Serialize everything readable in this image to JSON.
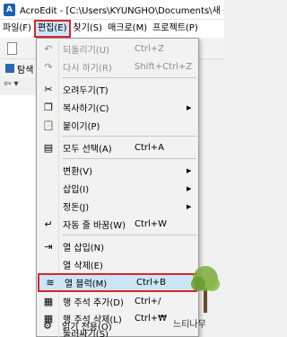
{
  "window": {
    "title": "AcroEdit - [C:\\Users\\KYUNGHO\\Documents\\새 문서",
    "icon_letter": "A"
  },
  "menubar": [
    {
      "label": "파일(F)"
    },
    {
      "label": "편집(E)",
      "active": true
    },
    {
      "label": "찾기(S)"
    },
    {
      "label": "매크로(M)"
    },
    {
      "label": "프로젝트(P)"
    }
  ],
  "side_tab": {
    "label": "탐색"
  },
  "side_nav": {
    "label": "⇦ ▾"
  },
  "edit_menu": {
    "items": [
      {
        "label": "되돌리기(U)",
        "shortcut": "Ctrl+Z",
        "icon": "undo-icon",
        "disabled": true
      },
      {
        "label": "다시 하기(R)",
        "shortcut": "Shift+Ctrl+Z",
        "icon": "redo-icon",
        "disabled": true
      },
      {
        "separator": true
      },
      {
        "label": "오려두기(T)",
        "icon": "scissors-icon"
      },
      {
        "label": "복사하기(C)",
        "icon": "copy-icon",
        "submenu": true
      },
      {
        "label": "붙이기(P)",
        "icon": "paste-icon"
      },
      {
        "separator": true
      },
      {
        "label": "모두 선택(A)",
        "shortcut": "Ctrl+A",
        "icon": "select-all-icon"
      },
      {
        "separator": true
      },
      {
        "label": "변환(V)",
        "submenu": true
      },
      {
        "label": "삽입(I)",
        "submenu": true
      },
      {
        "label": "정돈(J)",
        "submenu": true
      },
      {
        "label": "자동 줄 바꿈(W)",
        "shortcut": "Ctrl+W",
        "icon": "word-wrap-icon"
      },
      {
        "separator": true
      },
      {
        "label": "열 삽입(N)",
        "icon": "column-insert-icon"
      },
      {
        "label": "열 삭제(E)",
        "icon": "column-delete-icon"
      },
      {
        "label": "열 블럭(M)",
        "shortcut": "Ctrl+B",
        "icon": "column-block-icon",
        "highlight": true
      },
      {
        "label": "행 주석 추가(D)",
        "shortcut": "Ctrl+/",
        "icon": "add-line-comment-icon"
      },
      {
        "label": "행 주석 삭제(L)",
        "shortcut": "Ctrl+₩",
        "icon": "remove-line-comment-icon"
      },
      {
        "label": "둘러싸기(S)"
      },
      {
        "separator": true
      },
      {
        "label": "읽기 전용(O)",
        "icon": "lock-icon"
      }
    ]
  },
  "watermark": {
    "text": "느티나무"
  },
  "colors": {
    "highlight_border": "#d9262b",
    "highlight_bg": "#cde6f7"
  }
}
